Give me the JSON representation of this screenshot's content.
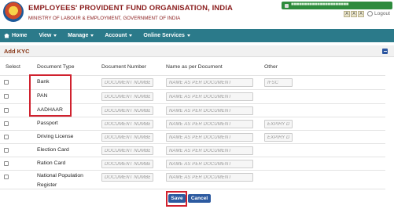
{
  "header": {
    "org_name": "EMPLOYEES' PROVIDENT FUND ORGANISATION, INDIA",
    "ministry": "MINISTRY OF LABOUR & EMPLOYMENT, GOVERNMENT OF INDIA",
    "user_text": "■■■■■■■■■■■■■■■■■■■■■■",
    "font_tools": [
      "A",
      "A",
      "A"
    ],
    "logout_label": "Logout"
  },
  "nav": {
    "home": "Home",
    "view": "View",
    "manage": "Manage",
    "account": "Account",
    "online_services": "Online Services"
  },
  "panel": {
    "title": "Add KYC"
  },
  "columns": {
    "select": "Select",
    "doc_type": "Document Type",
    "doc_number": "Document Number",
    "name": "Name as per Document",
    "other": "Other"
  },
  "placeholders": {
    "doc_number": "DOCUMENT NUMBER",
    "name": "NAME AS PER DOCUMENT"
  },
  "rows": [
    {
      "type": "Bank",
      "other": "IFSC"
    },
    {
      "type": "PAN",
      "other": ""
    },
    {
      "type": "AADHAAR",
      "other": ""
    },
    {
      "type": "Passport",
      "other": "EXPIRY DT"
    },
    {
      "type": "Driving License",
      "other": "EXPIRY DT"
    },
    {
      "type": "Election Card",
      "other": ""
    },
    {
      "type": "Ration Card",
      "other": ""
    },
    {
      "type_line1": "National Population",
      "type_line2": "Register",
      "other": ""
    }
  ],
  "buttons": {
    "save": "Save",
    "cancel": "Cancel"
  },
  "colors": {
    "navbar": "#2b7a8a",
    "org_red": "#8a1c1c",
    "highlight": "#d0212e",
    "button": "#2c5aa0",
    "badge": "#2e8b3d"
  }
}
